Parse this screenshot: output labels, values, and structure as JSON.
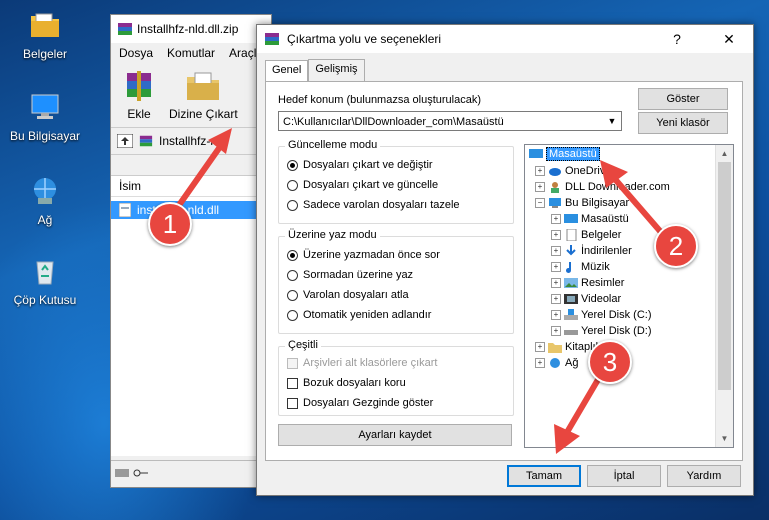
{
  "desktop": {
    "icons": [
      {
        "label": "Belgeler",
        "icon": "folder-documents-icon"
      },
      {
        "label": "Bu Bilgisayar",
        "icon": "computer-icon"
      },
      {
        "label": "Ağ",
        "icon": "network-icon"
      },
      {
        "label": "Çöp Kutusu",
        "icon": "recycle-bin-icon"
      }
    ]
  },
  "bg_window": {
    "title": "Installhfz-nld.dll.zip",
    "menu": [
      "Dosya",
      "Komutlar",
      "Araçla"
    ],
    "toolbar": [
      "Ekle",
      "Dizine Çıkart"
    ],
    "address": "Installhfz-nl",
    "column_header": "İsim",
    "file_row": "installhfz-nld.dll"
  },
  "dialog": {
    "title": "Çıkartma yolu ve seçenekleri",
    "help_button": "?",
    "close_button": "✕",
    "tabs": [
      "Genel",
      "Gelişmiş"
    ],
    "target_label": "Hedef konum (bulunmazsa oluşturulacak)",
    "target_value": "C:\\Kullanıcılar\\DllDownloader_com\\Masaüstü",
    "show_button": "Göster",
    "new_folder_button": "Yeni klasör",
    "update_group": {
      "title": "Güncelleme modu",
      "options": [
        "Dosyaları çıkart ve değiştir",
        "Dosyaları çıkart ve güncelle",
        "Sadece varolan dosyaları tazele"
      ],
      "selected": 0
    },
    "overwrite_group": {
      "title": "Üzerine yaz modu",
      "options": [
        "Üzerine yazmadan önce sor",
        "Sormadan üzerine yaz",
        "Varolan dosyaları atla",
        "Otomatik yeniden adlandır"
      ],
      "selected": 0
    },
    "misc_group": {
      "title": "Çeşitli",
      "options": [
        "Arşivleri alt klasörlere çıkart",
        "Bozuk dosyaları koru",
        "Dosyaları Gezginde göster"
      ]
    },
    "save_settings_button": "Ayarları kaydet",
    "tree": {
      "root": "Masaüstü",
      "items": [
        "OneDrive",
        "DLL Downloader.com",
        "Bu Bilgisayar",
        "Masaüstü",
        "Belgeler",
        "İndirilenler",
        "Müzik",
        "Resimler",
        "Videolar",
        "Yerel Disk (C:)",
        "Yerel Disk (D:)",
        "Kitaplıklar",
        "Ağ"
      ]
    },
    "ok_button": "Tamam",
    "cancel_button": "İptal",
    "help_btn": "Yardım"
  },
  "annotations": [
    "1",
    "2",
    "3"
  ],
  "colors": {
    "accent": "#3399ff",
    "annotation": "#e8463f"
  }
}
